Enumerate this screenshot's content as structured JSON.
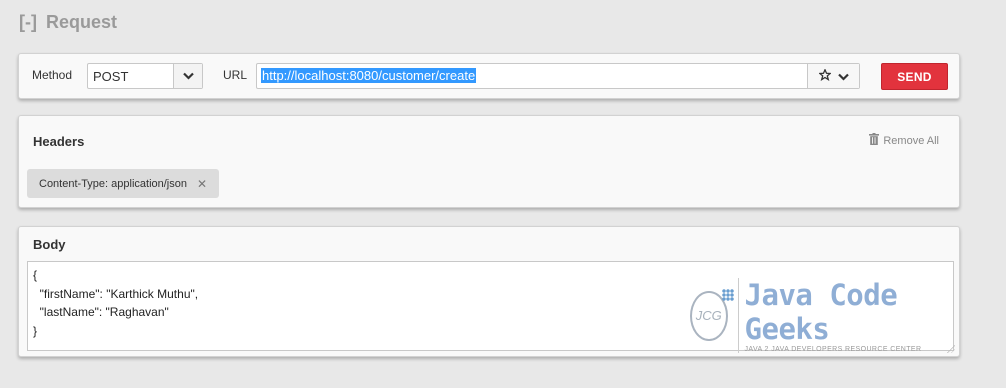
{
  "section": {
    "toggle": "[-]",
    "title": "Request"
  },
  "request": {
    "method_label": "Method",
    "method_value": "POST",
    "url_label": "URL",
    "url_value": "http://localhost:8080/customer/create",
    "send_label": "SEND",
    "send_color": "#e2333d"
  },
  "headers": {
    "title": "Headers",
    "remove_all": "Remove All",
    "items": [
      {
        "label": "Content-Type: application/json"
      }
    ]
  },
  "body": {
    "title": "Body",
    "content": "{\n  \"firstName\": \"Karthick Muthu\",\n  \"lastName\": \"Raghavan\"\n}"
  },
  "watermark": {
    "logo_text": "JCG",
    "brand": "Java Code Geeks",
    "tagline": "JAVA 2 JAVA DEVELOPERS RESOURCE CENTER"
  },
  "icons": {
    "method_caret": "chevron-down-icon",
    "url_star": "star-icon",
    "url_caret": "chevron-down-icon",
    "remove_all": "trash-icon",
    "chip_remove": "close-icon"
  }
}
